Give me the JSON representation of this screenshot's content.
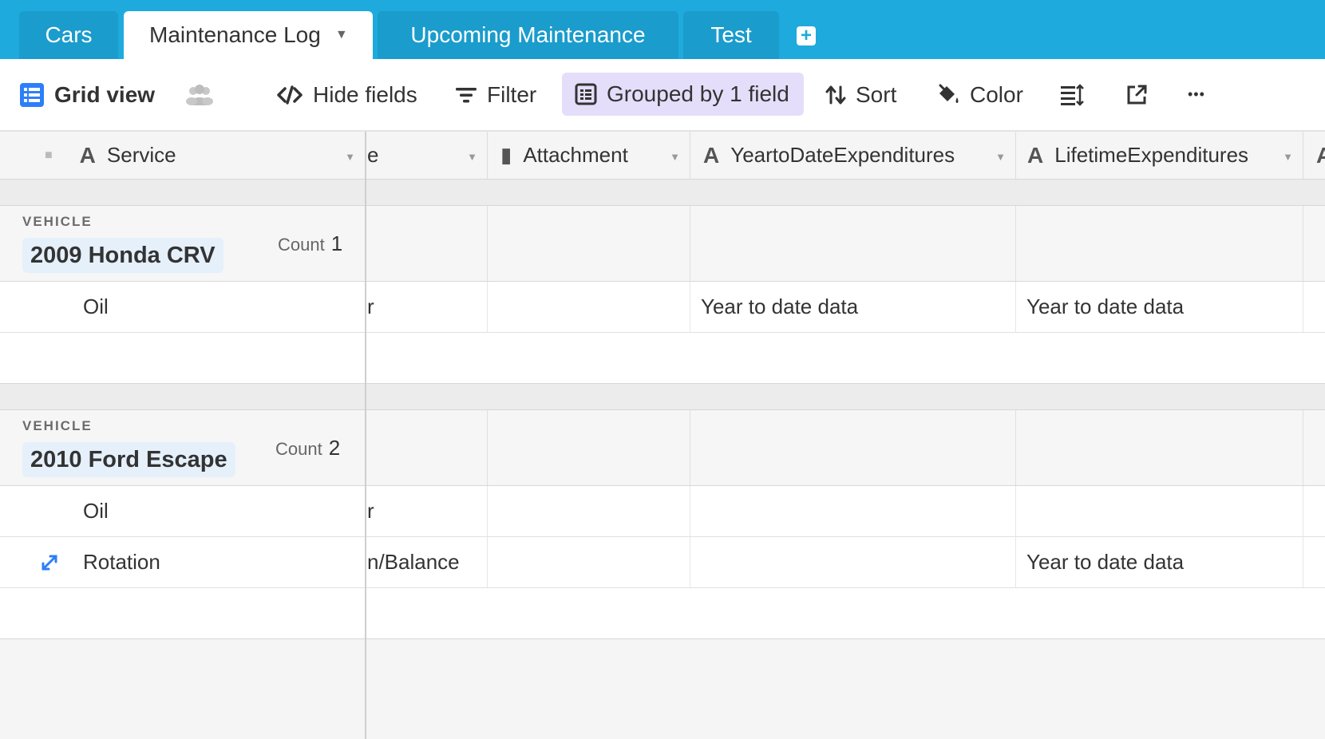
{
  "tabs": [
    {
      "label": "Cars"
    },
    {
      "label": "Maintenance Log"
    },
    {
      "label": "Upcoming Maintenance"
    },
    {
      "label": "Test"
    }
  ],
  "toolbar": {
    "view_name": "Grid view",
    "hide_fields": "Hide fields",
    "filter": "Filter",
    "grouped": "Grouped by 1 field",
    "sort": "Sort",
    "color": "Color",
    "more": "•••"
  },
  "columns": {
    "service": "Service",
    "partial": "e",
    "attachment": "Attachment",
    "ytd": "YeartoDateExpenditures",
    "lifetime": "LifetimeExpenditures"
  },
  "groups": [
    {
      "label": "VEHICLE",
      "name": "2009 Honda CRV",
      "count_label": "Count",
      "count": "1",
      "rows": [
        {
          "service": "Oil",
          "partial": "r",
          "attachment": "",
          "ytd": "Year to date data",
          "lifetime": "Year to date data"
        }
      ]
    },
    {
      "label": "VEHICLE",
      "name": "2010 Ford Escape",
      "count_label": "Count",
      "count": "2",
      "rows": [
        {
          "service": "Oil",
          "partial": "r",
          "attachment": "",
          "ytd": "",
          "lifetime": ""
        },
        {
          "service": "Rotation",
          "partial": "n/Balance",
          "attachment": "",
          "ytd": "",
          "lifetime": "Year to date data"
        }
      ]
    }
  ],
  "colors": {
    "tabbar": "#1eaadc",
    "grouped_bg": "#e5defa",
    "vehicle_chip": "#e5f0fb",
    "accent_icon": "#2d7ff9"
  }
}
